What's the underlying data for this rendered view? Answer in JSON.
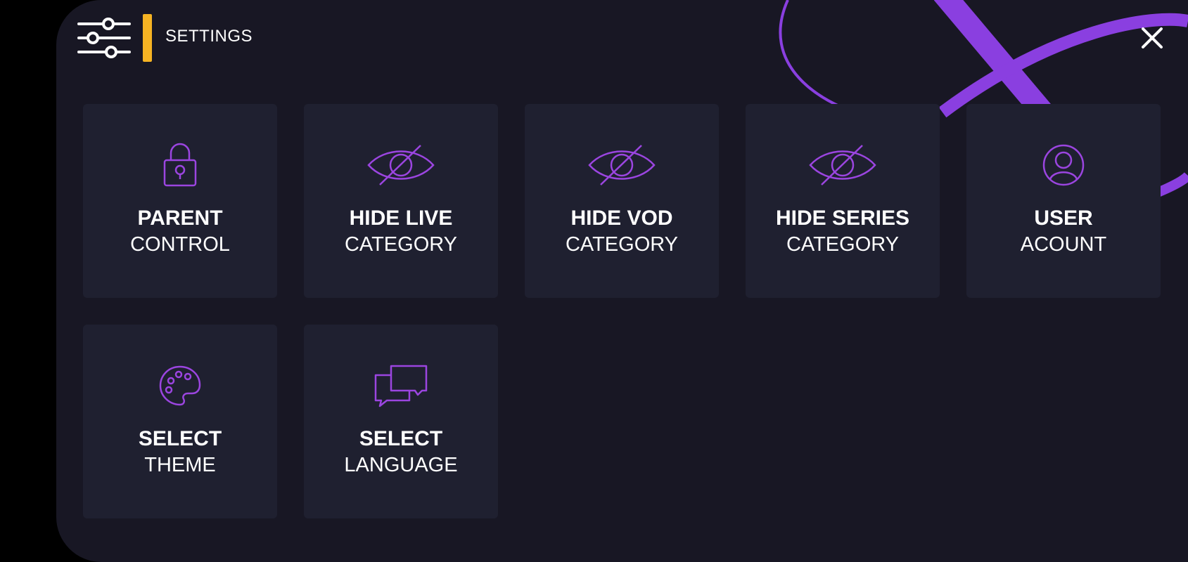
{
  "header": {
    "title": "SETTINGS",
    "settings_icon": "sliders-icon",
    "close_icon": "close-icon",
    "accent": "#f5b323"
  },
  "colors": {
    "background": "#181724",
    "tile": "#1f2030",
    "icon_purple": "#9b45e0"
  },
  "tiles": [
    {
      "line1": "PARENT",
      "line2": "CONTROL",
      "icon": "lock-icon"
    },
    {
      "line1": "HIDE LIVE",
      "line2": "CATEGORY",
      "icon": "eye-off-icon"
    },
    {
      "line1": "HIDE VOD",
      "line2": "CATEGORY",
      "icon": "eye-off-icon"
    },
    {
      "line1": "HIDE SERIES",
      "line2": "CATEGORY",
      "icon": "eye-off-icon"
    },
    {
      "line1": "USER",
      "line2": "ACOUNT",
      "icon": "user-icon"
    },
    {
      "line1": "SELECT",
      "line2": "THEME",
      "icon": "palette-icon"
    },
    {
      "line1": "SELECT",
      "line2": "LANGUAGE",
      "icon": "chat-bubbles-icon"
    }
  ]
}
